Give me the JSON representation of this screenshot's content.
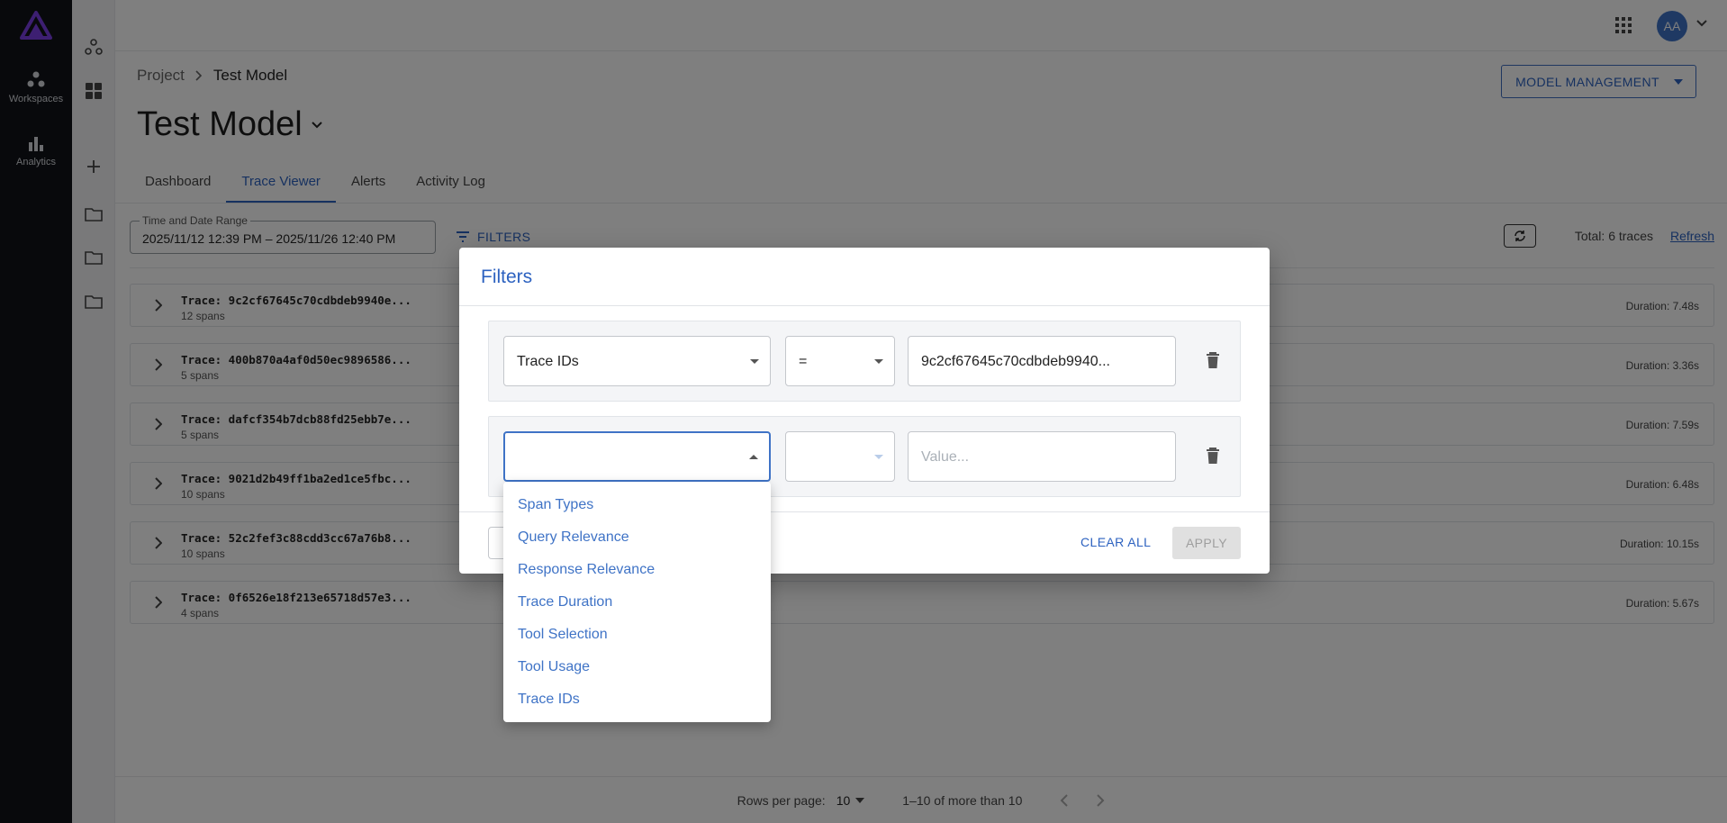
{
  "rail": {
    "items": [
      {
        "label": "Workspaces",
        "icon": "workspaces-icon"
      },
      {
        "label": "Analytics",
        "icon": "analytics-icon"
      }
    ]
  },
  "topbar": {
    "avatar_initials": "AA"
  },
  "breadcrumb": {
    "parent": "Project",
    "current": "Test Model"
  },
  "header": {
    "title": "Test Model",
    "model_management_label": "MODEL MANAGEMENT"
  },
  "tabs": [
    {
      "label": "Dashboard",
      "active": false
    },
    {
      "label": "Trace Viewer",
      "active": true
    },
    {
      "label": "Alerts",
      "active": false
    },
    {
      "label": "Activity Log",
      "active": false
    }
  ],
  "toolbar": {
    "date_label": "Time and Date Range",
    "date_value": "2025/11/12 12:39 PM – 2025/11/26 12:40 PM",
    "filters_label": "FILTERS",
    "total_text": "Total: 6 traces",
    "refresh_label": "Refresh"
  },
  "traces": [
    {
      "id": "Trace: 9c2cf67645c70cdbdeb9940e...",
      "spans": "12 spans",
      "duration": "Duration: 7.48s"
    },
    {
      "id": "Trace: 400b870a4af0d50ec9896586...",
      "spans": "5 spans",
      "duration": "Duration: 3.36s"
    },
    {
      "id": "Trace: dafcf354b7dcb88fd25ebb7e...",
      "spans": "5 spans",
      "duration": "Duration: 7.59s"
    },
    {
      "id": "Trace: 9021d2b49ff1ba2ed1ce5fbc...",
      "spans": "10 spans",
      "duration": "Duration: 6.48s"
    },
    {
      "id": "Trace: 52c2fef3c88cdd3cc67a76b8...",
      "spans": "10 spans",
      "duration": "Duration: 10.15s"
    },
    {
      "id": "Trace: 0f6526e18f213e65718d57e3...",
      "spans": "4 spans",
      "duration": "Duration: 5.67s"
    }
  ],
  "pagination": {
    "rows_label": "Rows per page:",
    "rows_value": "10",
    "range": "1–10 of more than 10"
  },
  "modal": {
    "title": "Filters",
    "row1": {
      "field": "Trace IDs",
      "operator": "=",
      "value": "9c2cf67645c70cdbdeb9940..."
    },
    "row2": {
      "field": "",
      "operator": "",
      "value_placeholder": "Value..."
    },
    "clear_all_label": "CLEAR ALL",
    "apply_label": "APPLY"
  },
  "field_menu": [
    "Span Types",
    "Query Relevance",
    "Response Relevance",
    "Trace Duration",
    "Tool Selection",
    "Tool Usage",
    "Trace IDs"
  ],
  "colors": {
    "accent": "#2d62c0",
    "rail": "#101318",
    "logo": "#7b3fe4"
  }
}
